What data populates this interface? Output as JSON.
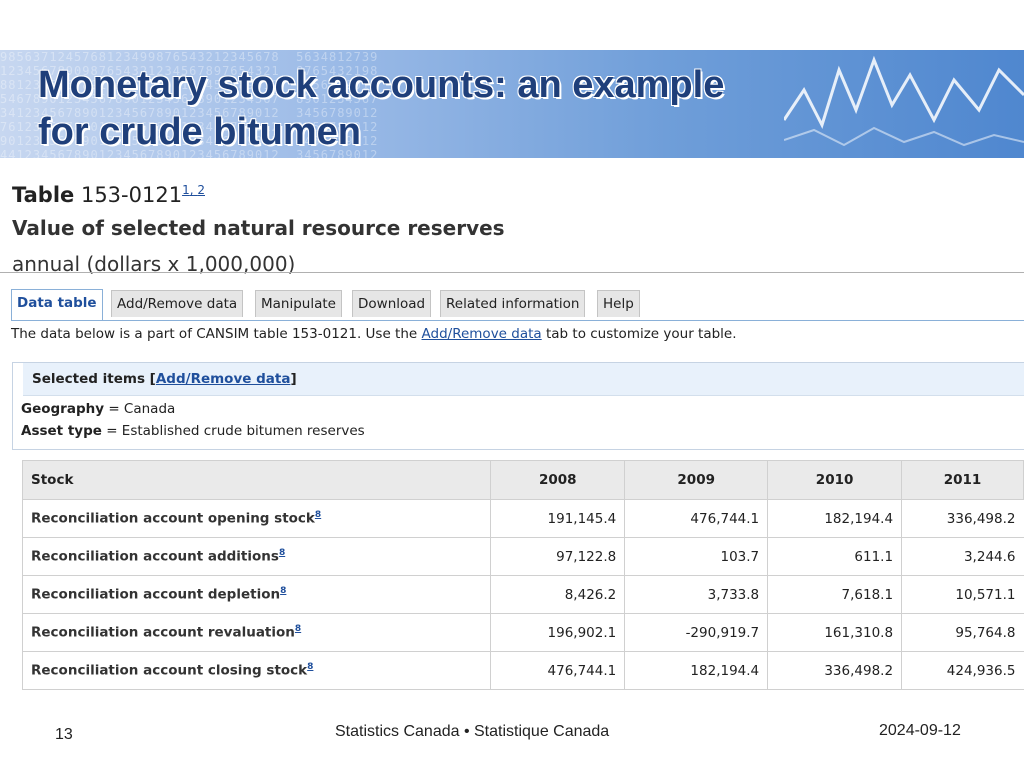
{
  "slide": {
    "title_line1": "Monetary stock accounts: an example",
    "title_line2": "for crude bitumen"
  },
  "cansim": {
    "table_label": "Table",
    "table_id": "153-0121",
    "footnote_1": "1",
    "footnote_sep": ",",
    "footnote_2": "2",
    "subtitle": "Value of selected natural resource reserves",
    "frequency": "annual (dollars x 1,000,000)"
  },
  "tabs": [
    {
      "label": "Data table",
      "active": true
    },
    {
      "label": "Add/Remove data",
      "active": false
    },
    {
      "label": "Manipulate",
      "active": false
    },
    {
      "label": "Download",
      "active": false
    },
    {
      "label": "Related information",
      "active": false
    },
    {
      "label": "Help",
      "active": false
    }
  ],
  "note": {
    "prefix": "The data below is a part of CANSIM table  153-0121.  Use the ",
    "link": "Add/Remove data",
    "suffix": "  tab to customize your table."
  },
  "selected": {
    "heading": "Selected items [",
    "heading_link": "Add/Remove data",
    "heading_end": "]",
    "geography_label": "Geography",
    "geography_value": " = Canada",
    "asset_label": "Asset type",
    "asset_value": " = Established crude bitumen reserves"
  },
  "table": {
    "stub_header": "Stock",
    "years": [
      "2008",
      "2009",
      "2010",
      "2011"
    ],
    "footnote_ref": "8",
    "rows": [
      {
        "label": "Reconciliation account opening stock",
        "values": [
          "191,145.4",
          "476,744.1",
          "182,194.4",
          "336,498.2"
        ]
      },
      {
        "label": "Reconciliation account additions",
        "values": [
          "97,122.8",
          "103.7",
          "611.1",
          "3,244.6"
        ]
      },
      {
        "label": "Reconciliation account depletion",
        "values": [
          "8,426.2",
          "3,733.8",
          "7,618.1",
          "10,571.1"
        ]
      },
      {
        "label": "Reconciliation account revaluation",
        "values": [
          "196,902.1",
          "-290,919.7",
          "161,310.8",
          "95,764.8"
        ]
      },
      {
        "label": "Reconciliation account closing stock",
        "values": [
          "476,744.1",
          "182,194.4",
          "336,498.2",
          "424,936.5"
        ]
      }
    ]
  },
  "footer": {
    "page_number": "13",
    "center": "Statistics Canada • Statistique Canada",
    "date": "2024-09-12"
  },
  "colors": {
    "title": "#1f3f7a",
    "link": "#1f4f9c",
    "banner_dark": "#4f87cf",
    "banner_light": "#c7d7f0"
  }
}
